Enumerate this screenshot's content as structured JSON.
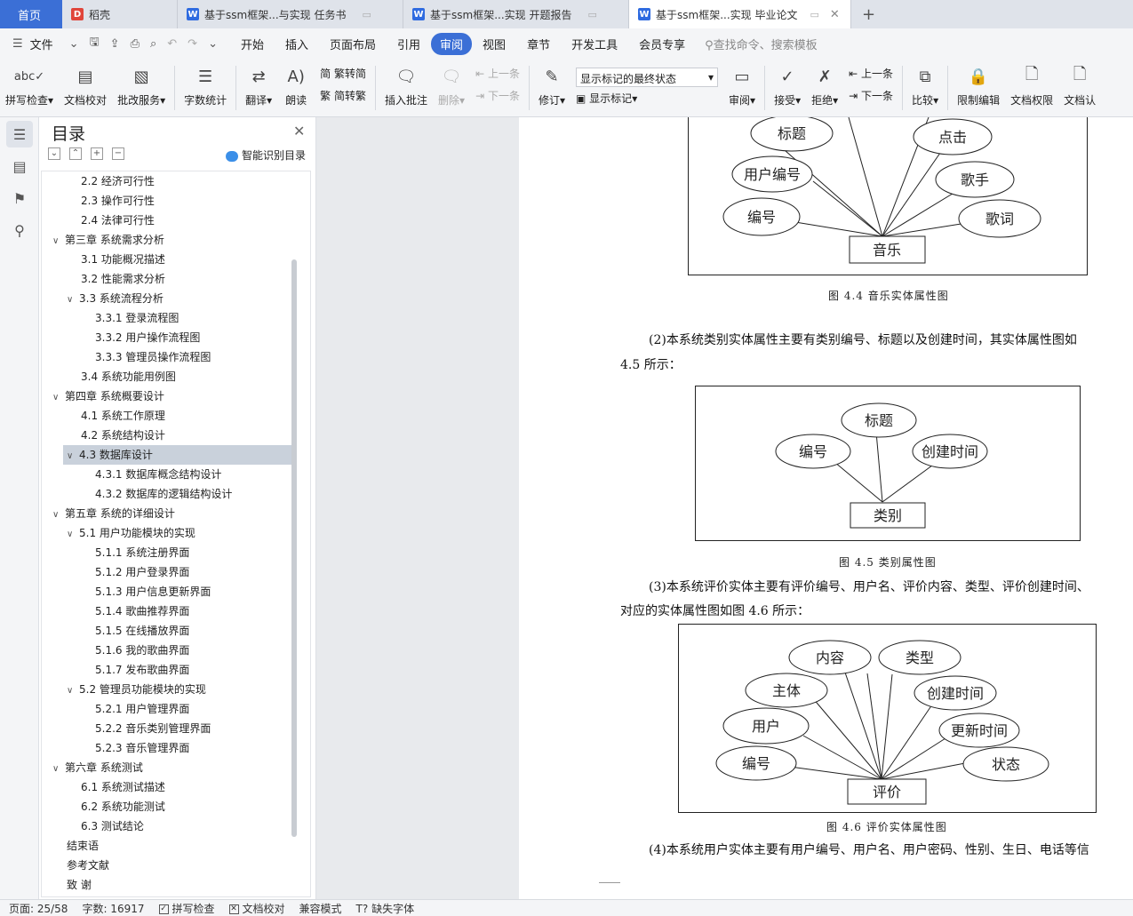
{
  "tabs": {
    "home": "首页",
    "items": [
      {
        "label": "稻壳",
        "icon": "docer-icon",
        "color": "#e0453a"
      },
      {
        "label": "基于ssm框架...与实现 任务书",
        "icon": "word-icon",
        "color": "#2f6be0"
      },
      {
        "label": "基于ssm框架...实现 开题报告",
        "icon": "word-icon",
        "color": "#2f6be0"
      },
      {
        "label": "基于ssm框架...实现 毕业论文",
        "icon": "word-icon",
        "color": "#2f6be0",
        "active": true
      }
    ],
    "add": "+"
  },
  "menu": {
    "file": "文件",
    "items": [
      "开始",
      "插入",
      "页面布局",
      "引用",
      "审阅",
      "视图",
      "章节",
      "开发工具",
      "会员专享"
    ],
    "active": "审阅",
    "search_placeholder": "查找命令、搜索模板"
  },
  "ribbon": {
    "spellcheck": "拼写检查",
    "proofread": "文档校对",
    "batch": "批改服务",
    "wordcount": "字数统计",
    "translate": "翻译",
    "read": "朗读",
    "to_trad": "繁转简",
    "to_simp": "简转繁",
    "insert_comment": "插入批注",
    "delete": "删除",
    "prev": "上一条",
    "next": "下一条",
    "revise": "修订",
    "markup_state": "显示标记的最终状态",
    "show_markup": "显示标记",
    "review": "审阅",
    "accept": "接受",
    "reject": "拒绝",
    "prev2": "上一条",
    "next2": "下一条",
    "compare": "比较",
    "restrict": "限制编辑",
    "permission": "文档权限",
    "doc_more": "文档认"
  },
  "toc": {
    "title": "目录",
    "smart": "智能识别目录",
    "items": [
      {
        "text": "2.2  经济可行性",
        "level": 2
      },
      {
        "text": "2.3  操作可行性",
        "level": 2
      },
      {
        "text": "2.4  法律可行性",
        "level": 2
      },
      {
        "text": "第三章  系统需求分析",
        "level": 1,
        "arrow": "v"
      },
      {
        "text": "3.1  功能概况描述",
        "level": 2
      },
      {
        "text": "3.2 性能需求分析",
        "level": 2
      },
      {
        "text": "3.3 系统流程分析",
        "level": 2,
        "arrow": "v"
      },
      {
        "text": "3.3.1 登录流程图",
        "level": 3
      },
      {
        "text": "3.3.2 用户操作流程图",
        "level": 3
      },
      {
        "text": "3.3.3 管理员操作流程图",
        "level": 3
      },
      {
        "text": "3.4 系统功能用例图",
        "level": 2
      },
      {
        "text": "第四章  系统概要设计",
        "level": 1,
        "arrow": "v"
      },
      {
        "text": "4.1 系统工作原理",
        "level": 2
      },
      {
        "text": "4.2  系统结构设计",
        "level": 2
      },
      {
        "text": "4.3  数据库设计",
        "level": 2,
        "arrow": "v",
        "selected": true
      },
      {
        "text": "4.3.1 数据库概念结构设计",
        "level": 3
      },
      {
        "text": "4.3.2 数据库的逻辑结构设计",
        "level": 3
      },
      {
        "text": "第五章  系统的详细设计",
        "level": 1,
        "arrow": "v"
      },
      {
        "text": "5.1  用户功能模块的实现",
        "level": 2,
        "arrow": "v"
      },
      {
        "text": "5.1.1 系统注册界面",
        "level": 3
      },
      {
        "text": "5.1.2 用户登录界面",
        "level": 3
      },
      {
        "text": "5.1.3 用户信息更新界面",
        "level": 3
      },
      {
        "text": "5.1.4 歌曲推荐界面",
        "level": 3
      },
      {
        "text": "5.1.5 在线播放界面",
        "level": 3
      },
      {
        "text": "5.1.6 我的歌曲界面",
        "level": 3
      },
      {
        "text": "5.1.7 发布歌曲界面",
        "level": 3
      },
      {
        "text": "5.2  管理员功能模块的实现",
        "level": 2,
        "arrow": "v"
      },
      {
        "text": "5.2.1 用户管理界面",
        "level": 3
      },
      {
        "text": "5.2.2 音乐类别管理界面",
        "level": 3
      },
      {
        "text": "5.2.3 音乐管理界面",
        "level": 3
      },
      {
        "text": "第六章  系统测试",
        "level": 1,
        "arrow": "v"
      },
      {
        "text": "6.1 系统测试描述",
        "level": 2
      },
      {
        "text": "6.2 系统功能测试",
        "level": 2
      },
      {
        "text": "6.3 测试结论",
        "level": 2
      },
      {
        "text": "结束语",
        "level": 1
      },
      {
        "text": "参考文献",
        "level": 1
      },
      {
        "text": "致    谢",
        "level": 1
      }
    ]
  },
  "document": {
    "fig44": {
      "caption": "图 4.4 音乐实体属性图",
      "entity": "音乐",
      "attrs": [
        "标题",
        "点击",
        "用户编号",
        "歌手",
        "编号",
        "歌词"
      ]
    },
    "para2_line1": "(2)本系统类别实体属性主要有类别编号、标题以及创建时间，其实体属性图如",
    "para2_line2": "4.5 所示：",
    "fig45": {
      "caption": "图 4.5  类别属性图",
      "entity": "类别",
      "attrs": [
        "标题",
        "编号",
        "创建时间"
      ]
    },
    "para3_line1": "(3)本系统评价实体主要有评价编号、用户名、评价内容、类型、评价创建时间、",
    "para3_line2": "对应的实体属性图如图 4.6 所示：",
    "fig46": {
      "caption": "图 4.6  评价实体属性图",
      "entity": "评价",
      "attrs": [
        "内容",
        "类型",
        "主体",
        "创建时间",
        "用户",
        "更新时间",
        "编号",
        "状态"
      ]
    },
    "para4_line1": "(4)本系统用户实体主要有用户编号、用户名、用户密码、性别、生日、电话等信"
  },
  "status": {
    "page": "页面: 25/58",
    "words": "字数: 16917",
    "spell": "拼写检查",
    "proof": "文档校对",
    "compat": "兼容模式",
    "missing_font": "缺失字体"
  }
}
